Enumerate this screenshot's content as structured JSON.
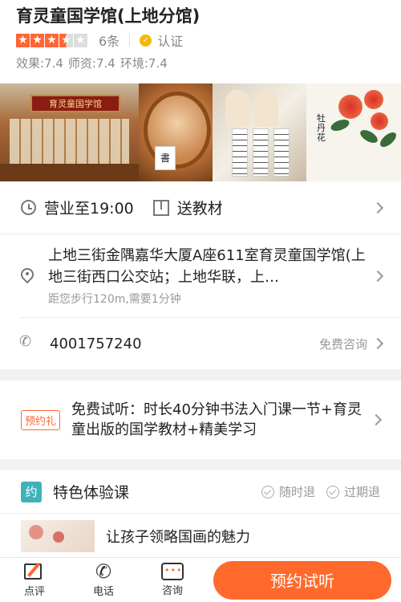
{
  "header": {
    "shop_name": "育灵童国学馆(上地分馆)",
    "rating_stars": 3.5,
    "review_count": "6条",
    "verify_label": "认证",
    "scores": [
      "效果:7.4",
      "师资:7.4",
      "环境:7.4"
    ]
  },
  "gallery": {
    "photo1_sign": "育灵童国学馆",
    "photo2_card": "書",
    "photo4_text": "牡丹花"
  },
  "info": {
    "hours": "营业至19:00",
    "material": "送教材",
    "address": "上地三街金隅嘉华大厦A座611室育灵童国学馆(上地三街西口公交站；上地华联，上…",
    "distance": "距您步行120m,需要1分钟",
    "phone": "4001757240",
    "consult_label": "免费咨询"
  },
  "promo": {
    "badge": "预约礼",
    "text": "免费试听：时长40分钟书法入门课一节+育灵童出版的国学教材+精美学习"
  },
  "course": {
    "badge": "约",
    "title": "特色体验课",
    "tags": [
      "随时退",
      "过期退"
    ],
    "item_name": "让孩子领略国画的魅力"
  },
  "bottom_bar": {
    "review_label": "点评",
    "phone_label": "电话",
    "chat_label": "咨询",
    "book_label": "预约试听"
  },
  "colors": {
    "accent": "#ff6633",
    "button": "#ff6a2c",
    "teal": "#3fb2b8",
    "verify": "#f5b700"
  }
}
